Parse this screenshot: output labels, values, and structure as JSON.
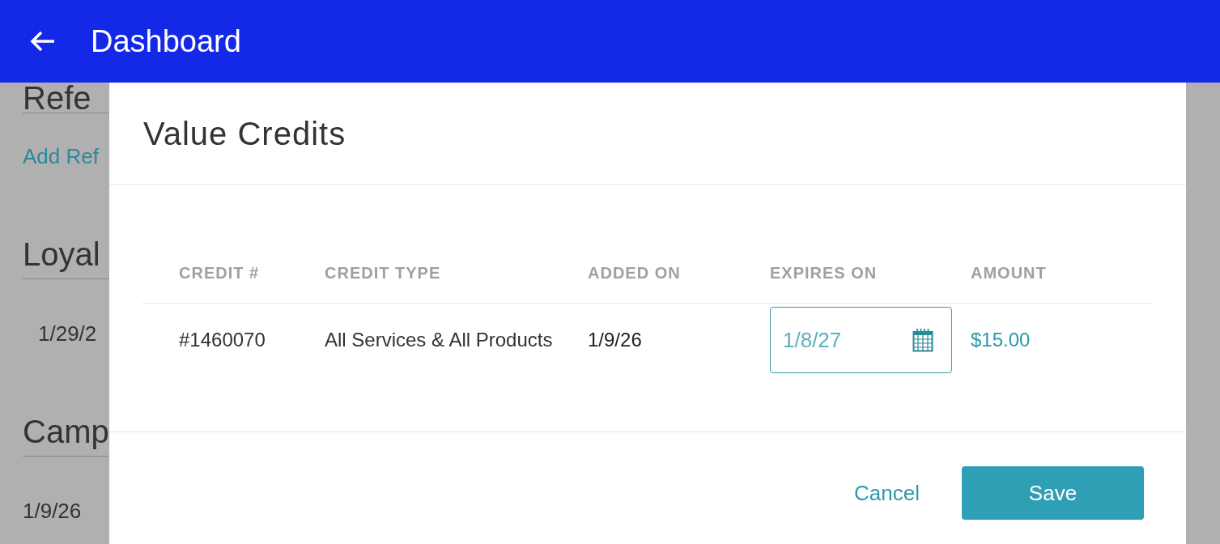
{
  "app_bar": {
    "title": "Dashboard"
  },
  "background": {
    "sections": [
      {
        "heading": "Refe",
        "link": "Add Ref"
      },
      {
        "heading": "Loyal",
        "entry": "1/29/2"
      },
      {
        "heading": "Camp",
        "entry": "1/9/26"
      }
    ]
  },
  "dialog": {
    "title": "Value Credits",
    "table": {
      "columns": [
        "CREDIT #",
        "CREDIT TYPE",
        "ADDED ON",
        "EXPIRES ON",
        "AMOUNT"
      ],
      "rows": [
        {
          "credit": "#1460070",
          "credit_type": "All Services & All Products",
          "added_on": "1/9/26",
          "expires_on": "1/8/27",
          "amount": "$15.00"
        }
      ]
    },
    "buttons": [
      {
        "label": "Cancel",
        "kind": "text"
      },
      {
        "label": "Save",
        "kind": "primary"
      }
    ]
  }
}
